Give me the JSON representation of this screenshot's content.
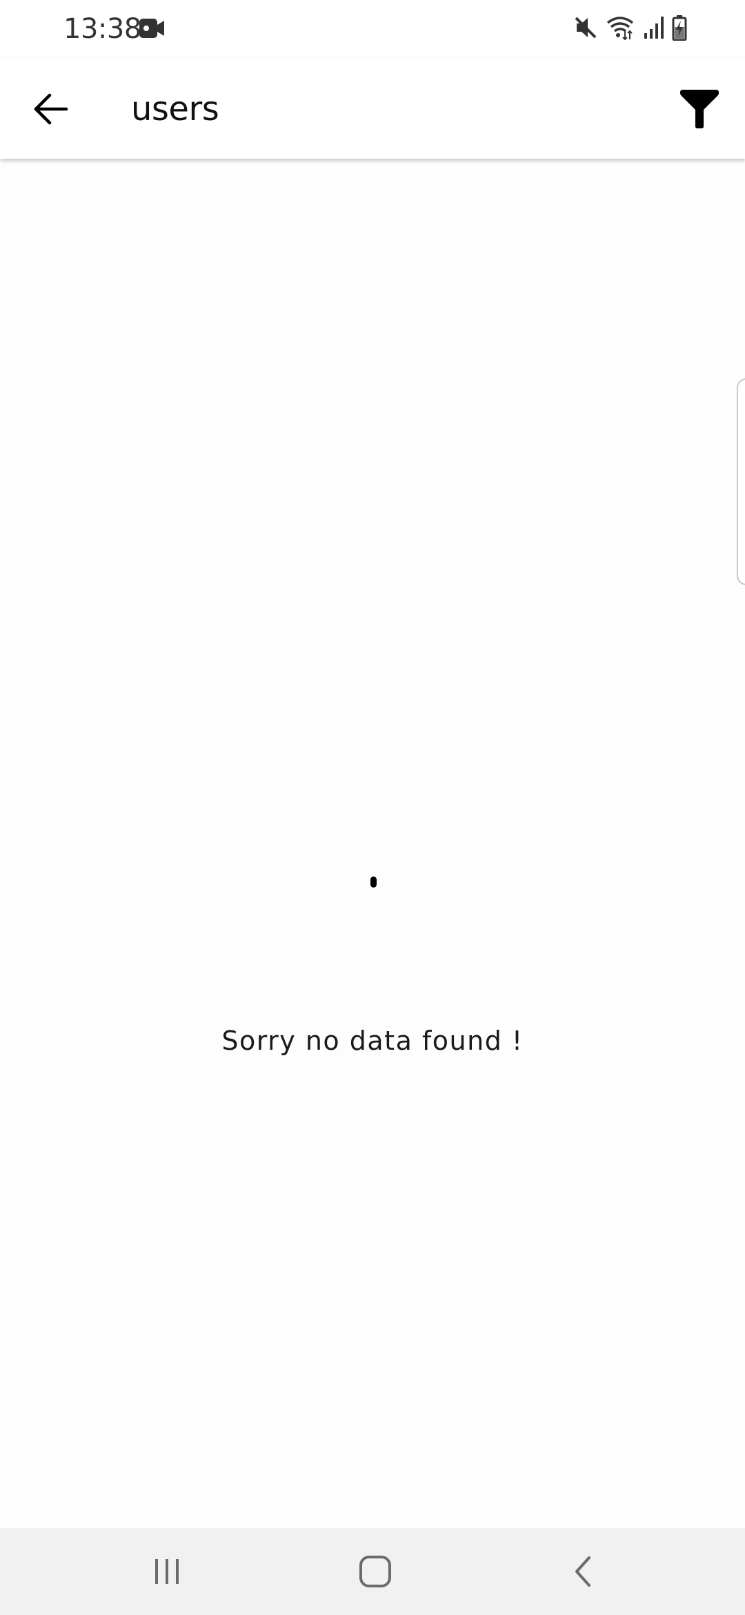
{
  "status_bar": {
    "time": "13:38",
    "icons": [
      "video-camera-icon",
      "mute-icon",
      "wifi-icon",
      "signal-icon",
      "battery-charging-icon"
    ]
  },
  "header": {
    "title": "users",
    "back_icon": "arrow-left-icon",
    "filter_icon": "filter-icon"
  },
  "main": {
    "empty_message": "Sorry no data found !"
  },
  "nav_bar": {
    "buttons": [
      "recent-apps-icon",
      "home-icon",
      "back-chevron-icon"
    ]
  },
  "colors": {
    "app_bar": "#ffffff",
    "background": "#fdfdfd",
    "nav_bar": "#f1f1f1",
    "icon": "#000000"
  }
}
